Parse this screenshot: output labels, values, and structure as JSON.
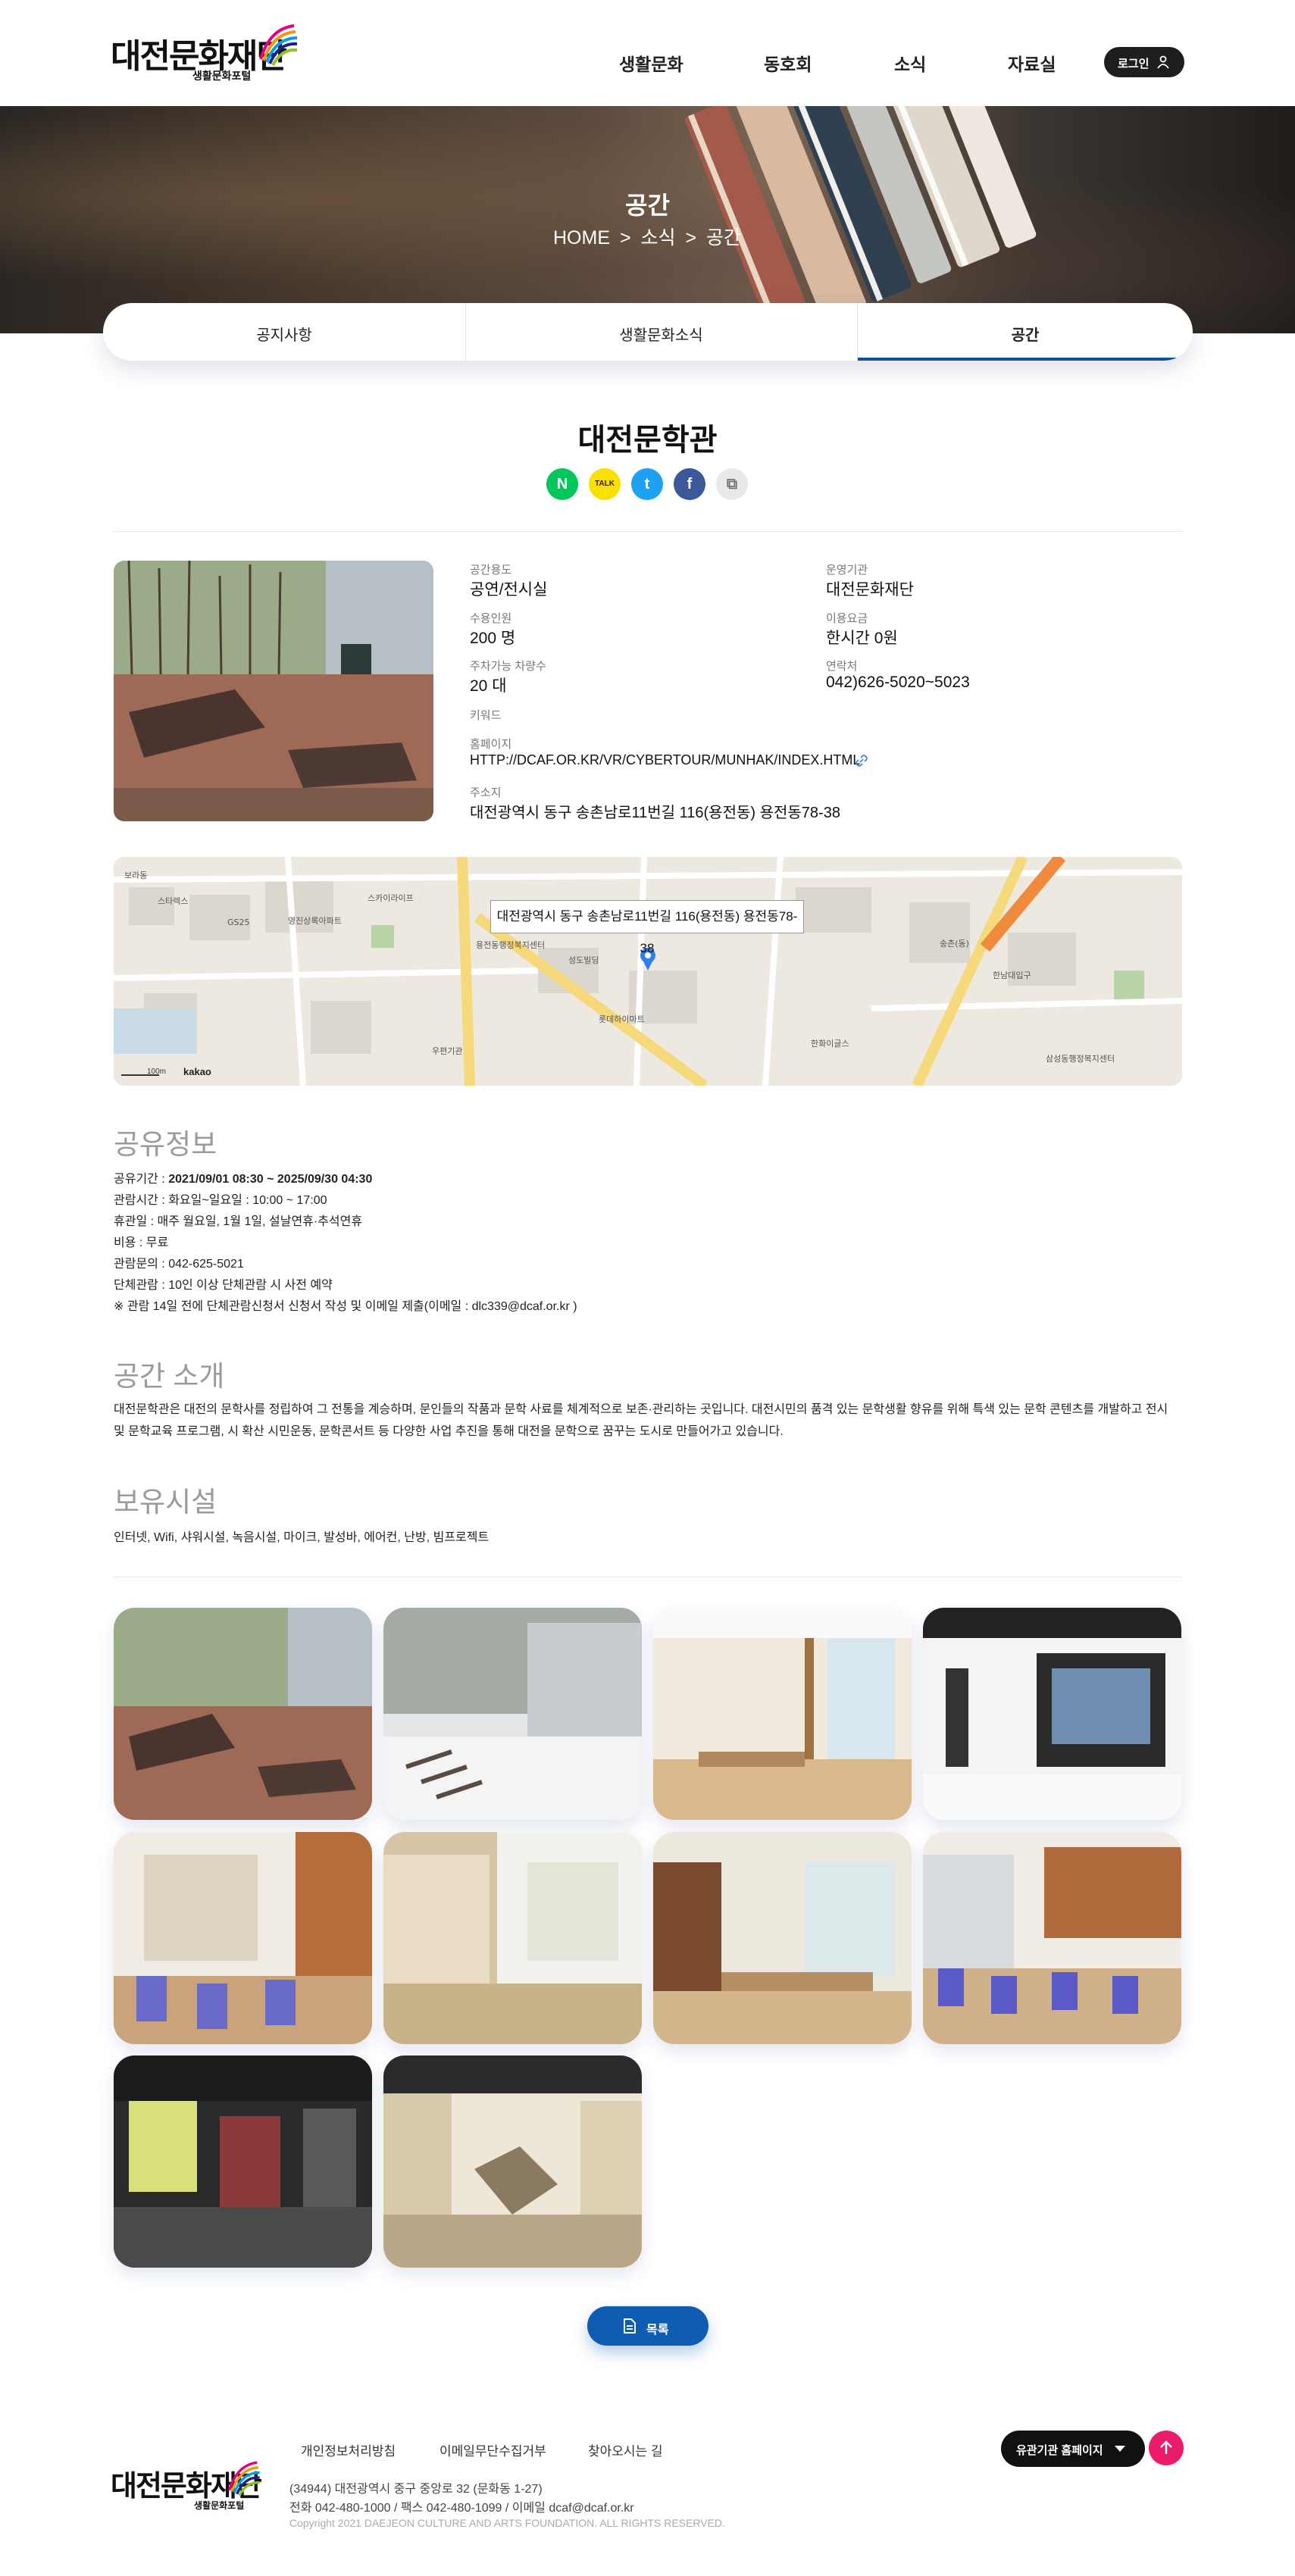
{
  "header": {
    "logo_text": "대전문화재단",
    "logo_sub": "생활문화포털",
    "nav": [
      "생활문화",
      "동호회",
      "소식",
      "자료실"
    ],
    "login_label": "로그인"
  },
  "hero": {
    "title": "공간",
    "breadcrumb": [
      "HOME",
      ">",
      "소식",
      ">",
      "공간"
    ]
  },
  "tabs": [
    "공지사항",
    "생활문화소식",
    "공간"
  ],
  "page": {
    "title": "대전문학관",
    "share": [
      "N",
      "TALK",
      "t",
      "f",
      "⧉"
    ]
  },
  "info": {
    "purpose_label": "공간용도",
    "purpose": "공연/전시실",
    "operator_label": "운영기관",
    "operator": "대전문화재단",
    "capacity_label": "수용인원",
    "capacity": "200 명",
    "fee_label": "이용요금",
    "fee": "한시간 0원",
    "parking_label": "주차가능 차량수",
    "parking": "20 대",
    "contact_label": "연락처",
    "contact": "042)626-5020~5023",
    "keyword_label": "키워드",
    "homepage_label": "홈페이지",
    "homepage": "HTTP://DCAF.OR.KR/VR/CYBERTOUR/MUNHAK/INDEX.HTML",
    "address_label": "주소지",
    "address": "대전광역시 동구 송촌남로11번길 116(용전동) 용전동78-38"
  },
  "map": {
    "popup": "대전광역시 동구 송촌남로11번길 116(용전동) 용전동78-38",
    "scale": "100m",
    "brand": "kakao"
  },
  "share_info": {
    "heading": "공유정보",
    "period_label": "공유기간 : ",
    "period": "2021/09/01 08:30 ~ 2025/09/30 04:30",
    "lines": [
      "관람시간 : 화요일~일요일 : 10:00 ~ 17:00",
      "휴관일 : 매주 월요일, 1월 1일, 설날연휴·추석연휴",
      "비용 : 무료",
      "관람문의 : 042-625-5021",
      "단체관람 : 10인 이상 단체관람 시 사전 예약",
      "※ 관람 14일 전에 단체관람신청서 신청서 작성 및 이메일 제출(이메일 : dlc339@dcaf.or.kr )"
    ]
  },
  "intro": {
    "heading": "공간 소개",
    "text": "대전문학관은 대전의 문학사를 정립하여 그 전통을 계승하며, 문인들의 작품과 문학 사료를 체계적으로 보존·관리하는 곳입니다. 대전시민의 품격 있는 문학생활 향유를 위해 특색 있는 문학 콘텐츠를 개발하고 전시 및 문학교육 프로그램, 시 확산 시민운동, 문학콘서트 등 다양한 사업 추진을 통해 대전을 문학으로 꿈꾸는 도시로 만들어가고 있습니다."
  },
  "facilities": {
    "heading": "보유시설",
    "text": "인터넷, Wifi, 샤워시설, 녹음시설, 마이크, 발성바, 에어컨, 난방, 빔프로젝트"
  },
  "list_button": "목록",
  "footer": {
    "links": [
      "개인정보처리방침",
      "이메일무단수집거부",
      "찾아오시는 길"
    ],
    "address": "(34944) 대전광역시 중구 중앙로 32 (문화동 1-27)",
    "contact": "전화 042-480-1000 / 팩스 042-480-1099 / 이메일 dcaf@dcaf.or.kr",
    "copyright": "Copyright 2021 DAEJEON CULTURE AND ARTS FOUNDATION. ALL RIGHTS RESERVED.",
    "related_label": "유관기관 홈페이지"
  }
}
